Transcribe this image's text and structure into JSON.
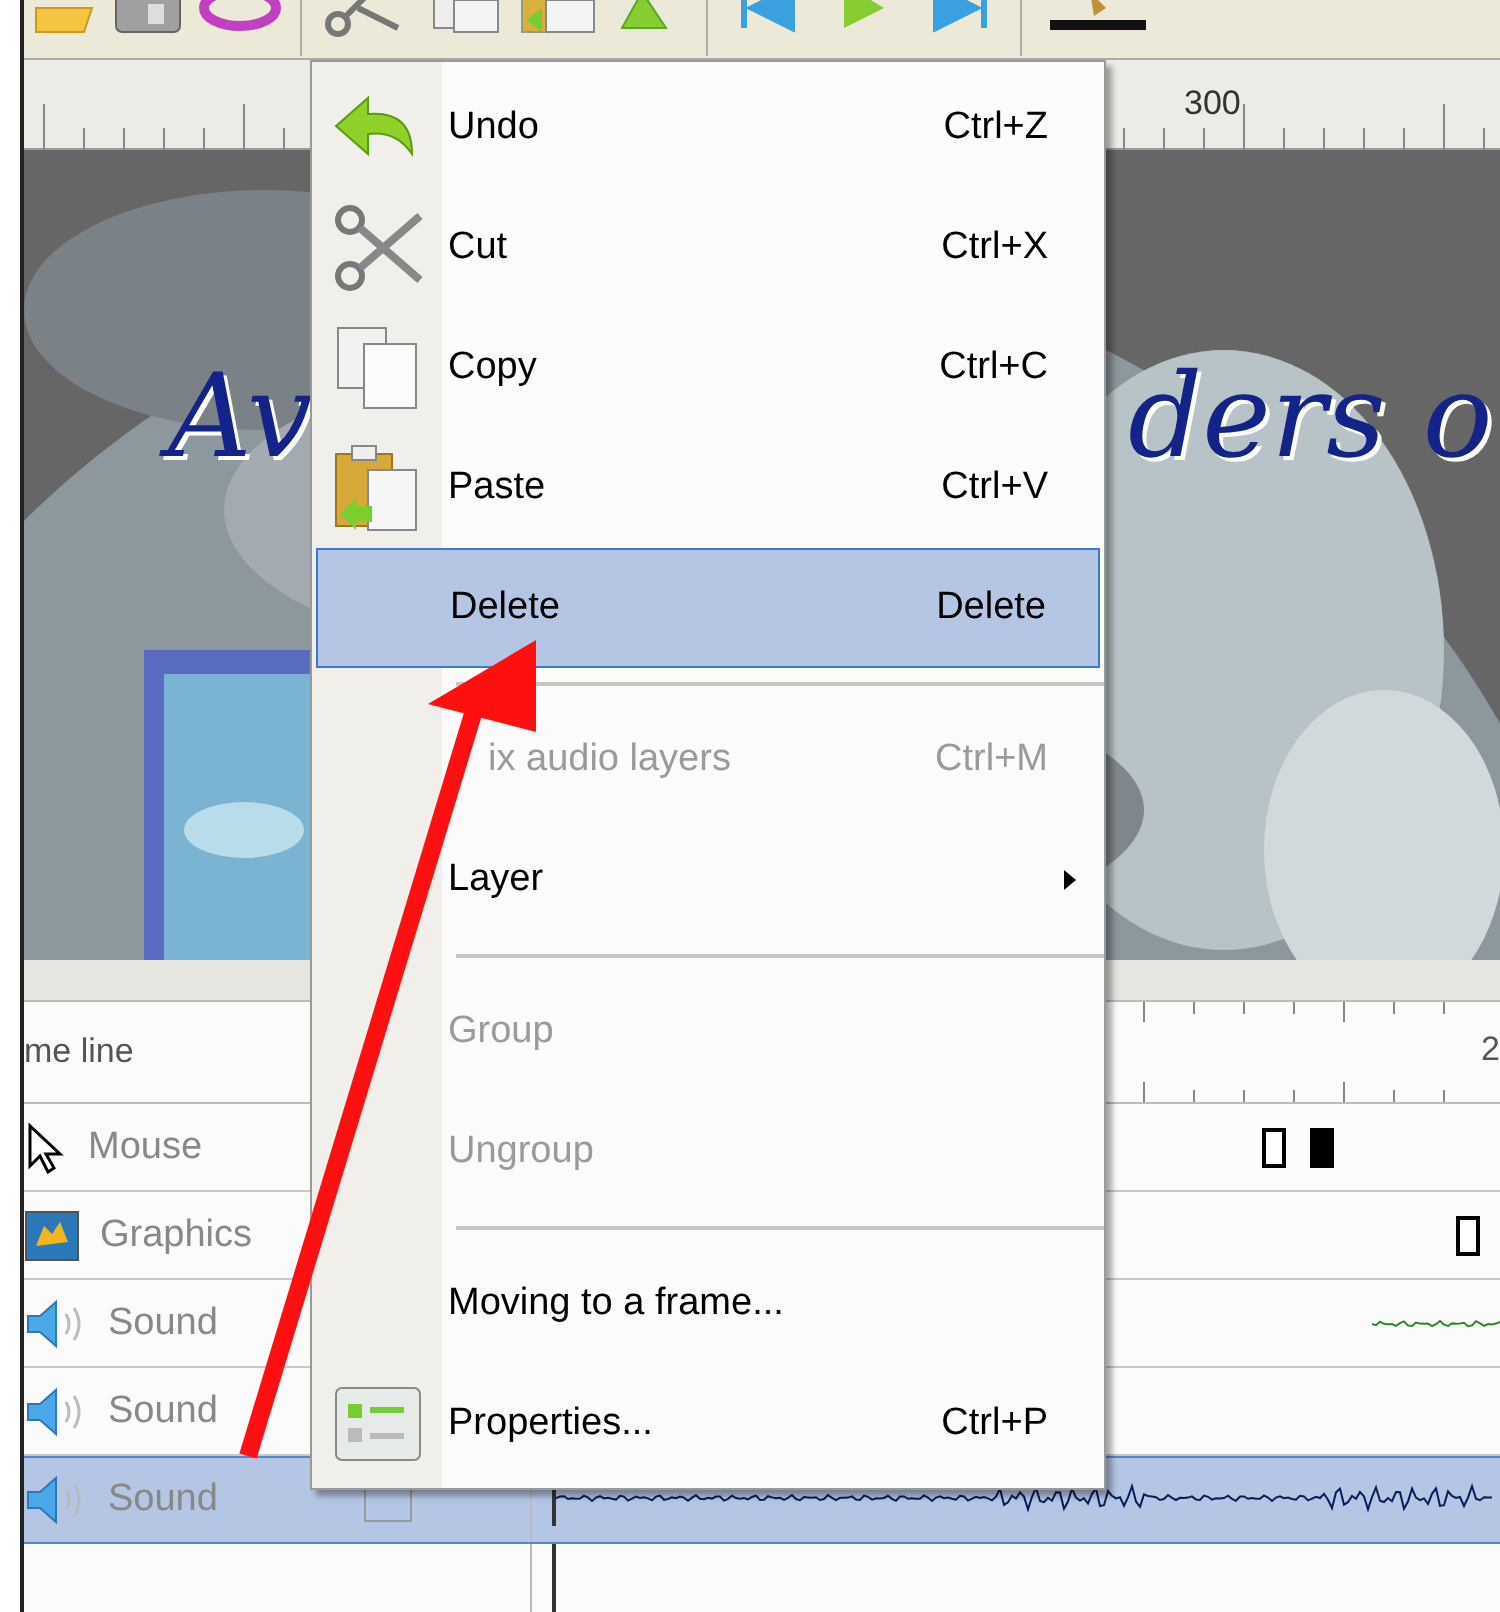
{
  "ruler": {
    "labels": [
      "300"
    ]
  },
  "slide": {
    "title_fragments": [
      "Av",
      "ders o"
    ]
  },
  "timeline": {
    "header": "me line",
    "ruler_label": "2",
    "layers": [
      {
        "name": "Mouse",
        "kind": "mouse",
        "selected": false
      },
      {
        "name": "Graphics",
        "kind": "graphics",
        "selected": false
      },
      {
        "name": "Sound",
        "kind": "sound",
        "selected": false
      },
      {
        "name": "Sound",
        "kind": "sound",
        "selected": false
      },
      {
        "name": "Sound",
        "kind": "sound",
        "selected": true
      }
    ]
  },
  "context_menu": {
    "items": [
      {
        "kind": "item",
        "label": "Undo",
        "shortcut": "Ctrl+Z",
        "disabled": false,
        "selected": false
      },
      {
        "kind": "item",
        "label": "Cut",
        "shortcut": "Ctrl+X",
        "disabled": false,
        "selected": false
      },
      {
        "kind": "item",
        "label": "Copy",
        "shortcut": "Ctrl+C",
        "disabled": false,
        "selected": false
      },
      {
        "kind": "item",
        "label": "Paste",
        "shortcut": "Ctrl+V",
        "disabled": false,
        "selected": false
      },
      {
        "kind": "item",
        "label": "Delete",
        "shortcut": "Delete",
        "disabled": false,
        "selected": true
      },
      {
        "kind": "separator"
      },
      {
        "kind": "item",
        "label": "ix audio layers",
        "shortcut": "Ctrl+M",
        "disabled": true,
        "selected": false
      },
      {
        "kind": "item",
        "label": "Layer",
        "submenu": true,
        "disabled": false,
        "selected": false
      },
      {
        "kind": "separator"
      },
      {
        "kind": "item",
        "label": "Group",
        "disabled": true,
        "selected": false
      },
      {
        "kind": "item",
        "label": "Ungroup",
        "disabled": true,
        "selected": false
      },
      {
        "kind": "separator"
      },
      {
        "kind": "item",
        "label": "Moving to a frame...",
        "disabled": false,
        "selected": false
      },
      {
        "kind": "item",
        "label": "Properties...",
        "shortcut": "Ctrl+P",
        "disabled": false,
        "selected": false
      }
    ]
  }
}
